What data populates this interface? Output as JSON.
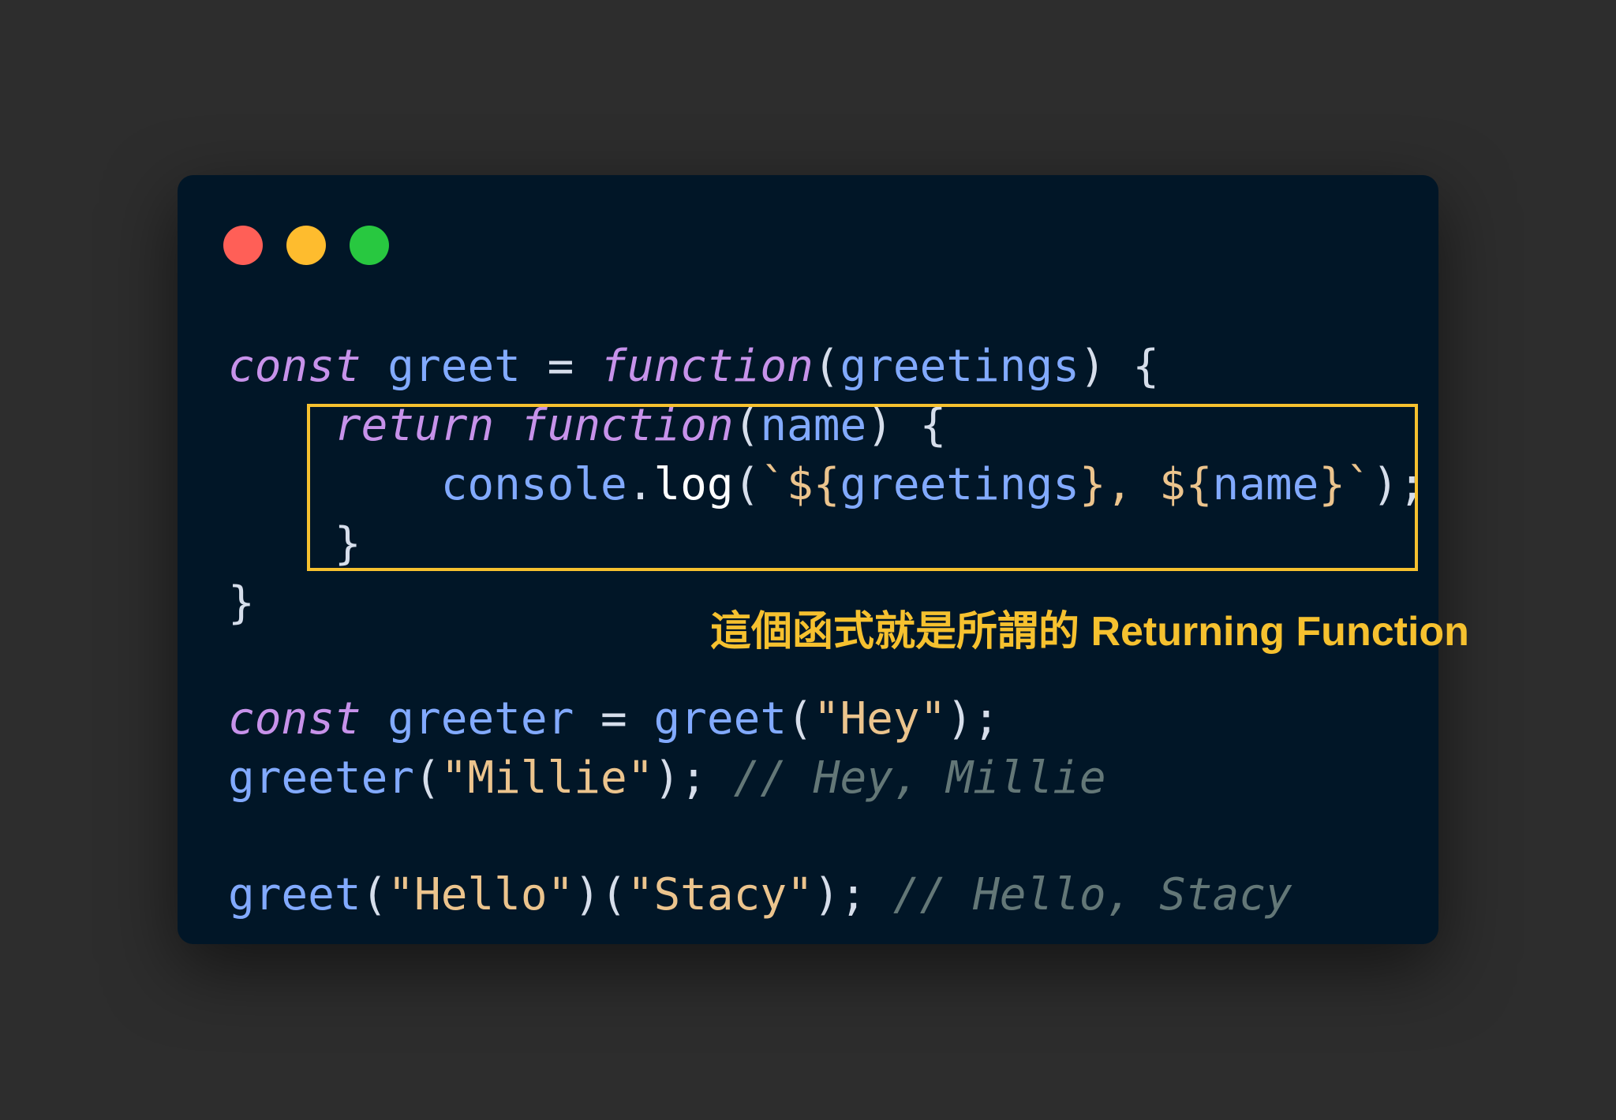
{
  "window": {
    "controls": [
      "close",
      "minimize",
      "zoom"
    ],
    "colors": {
      "background": "#011627",
      "close": "#ff5f57",
      "minimize": "#febc2e",
      "zoom": "#28c840"
    }
  },
  "code": {
    "line1": {
      "kw1": "const",
      "name": " greet ",
      "eq": "= ",
      "kw2": "function",
      "open": "(",
      "param": "greetings",
      "close": ") {"
    },
    "line2": {
      "indent": "    ",
      "kw1": "return",
      "sp": " ",
      "kw2": "function",
      "open": "(",
      "param": "name",
      "close": ") {"
    },
    "line3": {
      "indent": "        ",
      "obj": "console",
      "dot": ".",
      "method": "log",
      "open": "(",
      "tpl_start": "`${",
      "var1": "greetings",
      "tpl_mid": "}, ${",
      "var2": "name",
      "tpl_end": "}`",
      "close": ");"
    },
    "line4": {
      "indent": "    ",
      "brace": "}"
    },
    "line5": {
      "brace": "}"
    },
    "line6": {
      "kw1": "const",
      "name": " greeter ",
      "eq": "= ",
      "call": "greet",
      "open": "(",
      "arg": "\"Hey\"",
      "close": ");"
    },
    "line7": {
      "call": "greeter",
      "open": "(",
      "arg": "\"Millie\"",
      "close": "); ",
      "comment": "// Hey, Millie"
    },
    "line8": {
      "call": "greet",
      "open1": "(",
      "arg1": "\"Hello\"",
      "mid": ")(",
      "arg2": "\"Stacy\"",
      "close": "); ",
      "comment": "// Hello, Stacy"
    }
  },
  "annotation": {
    "text": "這個函式就是所謂的 Returning Function",
    "color": "#f6c12f"
  }
}
